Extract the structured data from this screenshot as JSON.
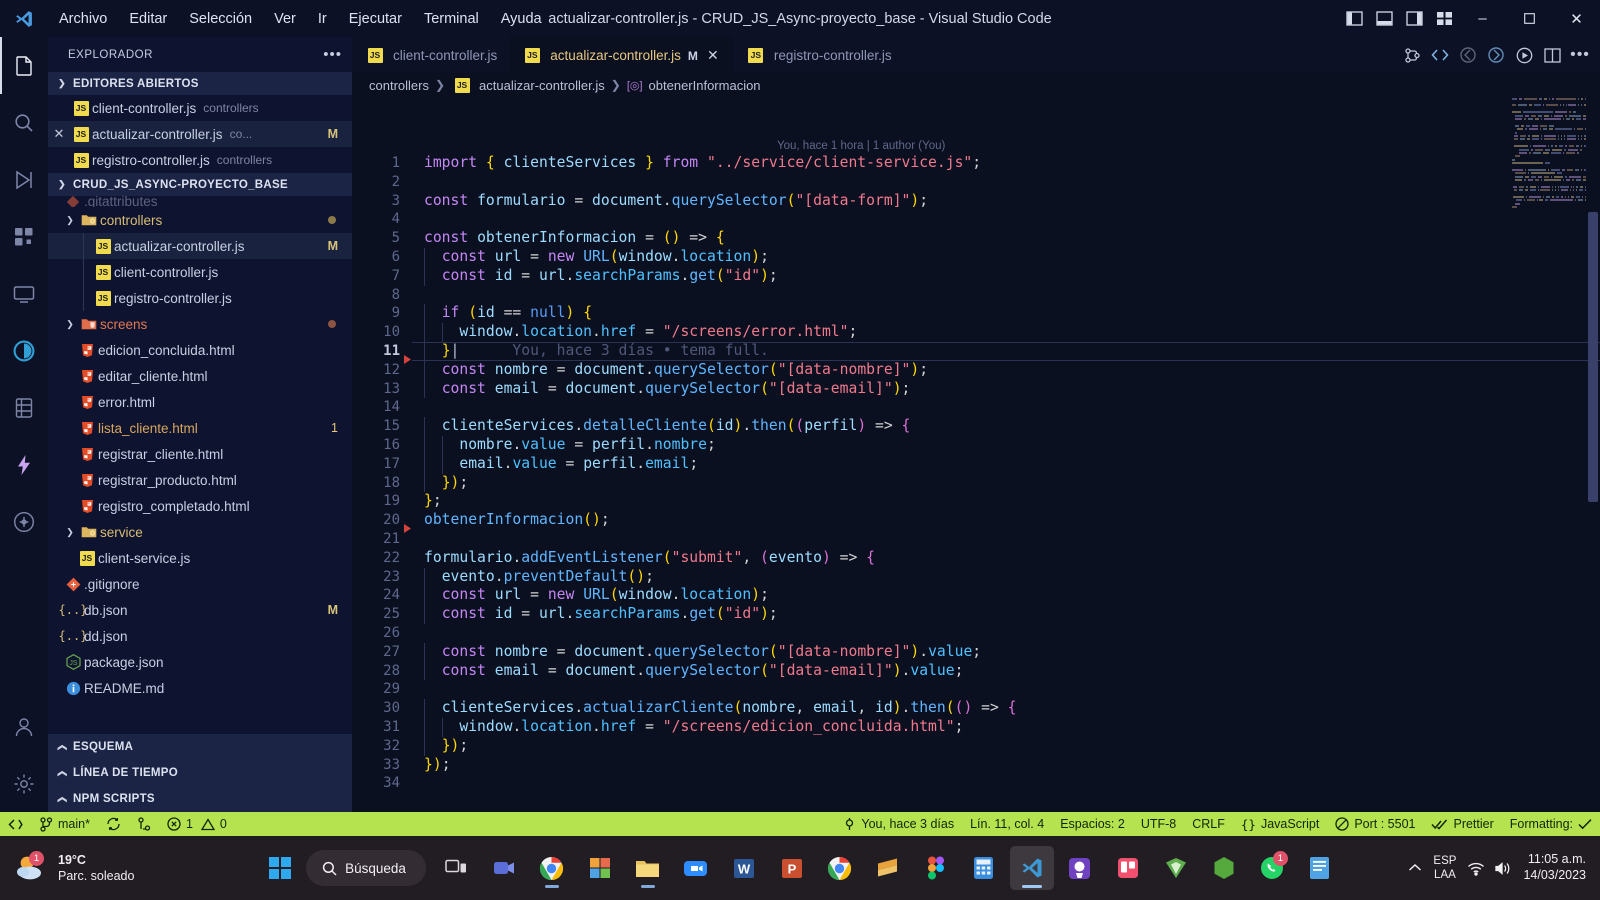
{
  "titlebar": {
    "logo_icon": "vscode-logo-icon",
    "menus": [
      "Archivo",
      "Editar",
      "Selección",
      "Ver",
      "Ir",
      "Ejecutar",
      "Terminal",
      "Ayuda"
    ],
    "window_title": "actualizar-controller.js - CRUD_JS_Async-proyecto_base - Visual Studio Code",
    "layout_icons": [
      "toggle-primary-sidebar-icon",
      "toggle-panel-icon",
      "toggle-secondary-sidebar-icon",
      "customize-layout-icon"
    ],
    "window_controls": {
      "minimize": "–",
      "maximize": "❐",
      "close": "✕"
    }
  },
  "activitybar": {
    "items": [
      {
        "name": "explorer",
        "icon": "files-icon",
        "active": true
      },
      {
        "name": "search",
        "icon": "search-icon",
        "active": false
      },
      {
        "name": "run-and-debug",
        "icon": "debug-icon",
        "active": false
      },
      {
        "name": "extensions",
        "icon": "extensions-icon",
        "active": false
      },
      {
        "name": "remote-explorer",
        "icon": "remote-monitor-icon",
        "active": false
      },
      {
        "name": "docker",
        "icon": "docker-whale-icon",
        "active": false
      },
      {
        "name": "database",
        "icon": "database-icon",
        "active": false
      },
      {
        "name": "thunder-client",
        "icon": "lightning-bolt-icon",
        "active": false
      },
      {
        "name": "live-share",
        "icon": "live-share-icon",
        "active": false
      }
    ],
    "bottom": [
      {
        "name": "accounts",
        "icon": "account-icon"
      },
      {
        "name": "manage-settings",
        "icon": "gear-icon"
      }
    ]
  },
  "sidebar": {
    "title": "EXPLORADOR",
    "more_actions_icon": "ellipsis-icon",
    "open_editors": {
      "label": "EDITORES ABIERTOS",
      "expanded": true,
      "items": [
        {
          "name": "client-controller.js",
          "folder": "controllers",
          "icon": "js-file-icon",
          "modified": false,
          "active": false,
          "show_close": false
        },
        {
          "name": "actualizar-controller.js",
          "folder": "co...",
          "icon": "js-file-icon",
          "modified": true,
          "badge": "M",
          "active": true,
          "show_close": true
        },
        {
          "name": "registro-controller.js",
          "folder": "controllers",
          "icon": "js-file-icon",
          "modified": false,
          "active": false,
          "show_close": false
        }
      ]
    },
    "project": {
      "label": "CRUD_JS_ASYNC-PROYECTO_BASE",
      "expanded": true,
      "items": [
        {
          "name": "controllers",
          "type": "folder",
          "icon": "folder-gear-icon",
          "indent": 1,
          "expanded": true,
          "dot": true
        },
        {
          "name": "actualizar-controller.js",
          "type": "file",
          "icon": "js-file-icon",
          "indent": 3,
          "badge": "M",
          "selected": true,
          "guide": true
        },
        {
          "name": "client-controller.js",
          "type": "file",
          "icon": "js-file-icon",
          "indent": 3,
          "guide": true
        },
        {
          "name": "registro-controller.js",
          "type": "file",
          "icon": "js-file-icon",
          "indent": 3,
          "guide": true
        },
        {
          "name": "screens",
          "type": "folder",
          "icon": "folder-html-icon",
          "indent": 1,
          "expanded": true,
          "dot": true
        },
        {
          "name": "edicion_concluida.html",
          "type": "file",
          "icon": "html5-icon",
          "indent": 2
        },
        {
          "name": "editar_cliente.html",
          "type": "file",
          "icon": "html5-icon",
          "indent": 2
        },
        {
          "name": "error.html",
          "type": "file",
          "icon": "html5-icon",
          "indent": 2
        },
        {
          "name": "lista_cliente.html",
          "type": "file",
          "icon": "html5-icon",
          "indent": 2,
          "badge_num": "1",
          "warn": true
        },
        {
          "name": "registrar_cliente.html",
          "type": "file",
          "icon": "html5-icon",
          "indent": 2
        },
        {
          "name": "registrar_producto.html",
          "type": "file",
          "icon": "html5-icon",
          "indent": 2
        },
        {
          "name": "registro_completado.html",
          "type": "file",
          "icon": "html5-icon",
          "indent": 2
        },
        {
          "name": "service",
          "type": "folder",
          "icon": "folder-gear-icon",
          "indent": 1,
          "expanded": true
        },
        {
          "name": "client-service.js",
          "type": "file",
          "icon": "js-file-icon",
          "indent": 2
        },
        {
          "name": ".gitignore",
          "type": "file",
          "icon": "git-icon",
          "indent": 1
        },
        {
          "name": "db.json",
          "type": "file",
          "icon": "json-icon",
          "indent": 1,
          "badge": "M"
        },
        {
          "name": "dd.json",
          "type": "file",
          "icon": "json-icon",
          "indent": 1
        },
        {
          "name": "package.json",
          "type": "file",
          "icon": "nodejs-icon",
          "indent": 1
        },
        {
          "name": "README.md",
          "type": "file",
          "icon": "info-icon",
          "indent": 1
        }
      ]
    },
    "collapsed_sections": [
      {
        "label": "ESQUEMA"
      },
      {
        "label": "LÍNEA DE TIEMPO"
      },
      {
        "label": "NPM SCRIPTS"
      }
    ]
  },
  "editor": {
    "tabs": [
      {
        "label": "client-controller.js",
        "icon": "js-file-icon",
        "active": false,
        "modified": false
      },
      {
        "label": "actualizar-controller.js",
        "icon": "js-file-icon",
        "active": true,
        "modified": true,
        "modified_badge": "M",
        "close_icon": "close-icon"
      },
      {
        "label": "registro-controller.js",
        "icon": "js-file-icon",
        "active": false,
        "modified": false
      }
    ],
    "tab_actions": [
      "source-control-graph-icon",
      "live-share-icon",
      "go-live-back-icon",
      "go-live-forward-icon",
      "run-play-icon",
      "split-editor-icon",
      "more-actions-icon"
    ],
    "breadcrumb": [
      {
        "label": "controllers",
        "icon": null
      },
      {
        "label": "actualizar-controller.js",
        "icon": "js-file-icon"
      },
      {
        "label": "obtenerInformacion",
        "icon": "symbol-variable-icon"
      }
    ],
    "blame_author_line": "You, hace 1 hora | 1 author (You)",
    "current_line_blame": "You, hace 3 días • tema full.",
    "cursor_line": 11,
    "total_lines": 34,
    "breakpoint_lines": [
      11,
      20
    ]
  },
  "code_lines": [
    {
      "n": 1,
      "text": "import { clienteServices } from \"../service/client-service.js\";"
    },
    {
      "n": 2,
      "text": ""
    },
    {
      "n": 3,
      "text": "const formulario = document.querySelector(\"[data-form]\");"
    },
    {
      "n": 4,
      "text": ""
    },
    {
      "n": 5,
      "text": "const obtenerInformacion = () => {"
    },
    {
      "n": 6,
      "text": "  const url = new URL(window.location);"
    },
    {
      "n": 7,
      "text": "  const id = url.searchParams.get(\"id\");"
    },
    {
      "n": 8,
      "text": ""
    },
    {
      "n": 9,
      "text": "  if (id == null) {"
    },
    {
      "n": 10,
      "text": "    window.location.href = \"/screens/error.html\";"
    },
    {
      "n": 11,
      "text": "  }"
    },
    {
      "n": 12,
      "text": "  const nombre = document.querySelector(\"[data-nombre]\");"
    },
    {
      "n": 13,
      "text": "  const email = document.querySelector(\"[data-email]\");"
    },
    {
      "n": 14,
      "text": ""
    },
    {
      "n": 15,
      "text": "  clienteServices.detalleCliente(id).then((perfil) => {"
    },
    {
      "n": 16,
      "text": "    nombre.value = perfil.nombre;"
    },
    {
      "n": 17,
      "text": "    email.value = perfil.email;"
    },
    {
      "n": 18,
      "text": "  });"
    },
    {
      "n": 19,
      "text": "};"
    },
    {
      "n": 20,
      "text": "obtenerInformacion();"
    },
    {
      "n": 21,
      "text": ""
    },
    {
      "n": 22,
      "text": "formulario.addEventListener(\"submit\", (evento) => {"
    },
    {
      "n": 23,
      "text": "  evento.preventDefault();"
    },
    {
      "n": 24,
      "text": "  const url = new URL(window.location);"
    },
    {
      "n": 25,
      "text": "  const id = url.searchParams.get(\"id\");"
    },
    {
      "n": 26,
      "text": ""
    },
    {
      "n": 27,
      "text": "  const nombre = document.querySelector(\"[data-nombre]\").value;"
    },
    {
      "n": 28,
      "text": "  const email = document.querySelector(\"[data-email]\").value;"
    },
    {
      "n": 29,
      "text": ""
    },
    {
      "n": 30,
      "text": "  clienteServices.actualizarCliente(nombre, email, id).then(() => {"
    },
    {
      "n": 31,
      "text": "    window.location.href = \"/screens/edicion_concluida.html\";"
    },
    {
      "n": 32,
      "text": "  });"
    },
    {
      "n": 33,
      "text": "});"
    },
    {
      "n": 34,
      "text": ""
    }
  ],
  "statusbar": {
    "background_color": "#b4e34f",
    "left": [
      {
        "name": "remote-host",
        "icon": "remote-icon",
        "label": ""
      },
      {
        "name": "branch",
        "icon": "source-control-icon",
        "label": "main*"
      },
      {
        "name": "sync-changes",
        "icon": "sync-icon",
        "label": ""
      },
      {
        "name": "checkout-branch",
        "icon": "git-branch-icon",
        "label": ""
      },
      {
        "name": "problems",
        "icon": "error-warning-icon",
        "label": "1  0",
        "errors": "1",
        "warnings": "0"
      }
    ],
    "right": [
      {
        "name": "git-blame",
        "icon": "git-commit-icon",
        "label": "You, hace 3 días"
      },
      {
        "name": "cursor-position",
        "label": "Lín. 11, col. 4"
      },
      {
        "name": "indentation",
        "label": "Espacios: 2"
      },
      {
        "name": "encoding",
        "label": "UTF-8"
      },
      {
        "name": "eol",
        "label": "CRLF"
      },
      {
        "name": "language-mode",
        "icon": "braces-icon",
        "label": "JavaScript"
      },
      {
        "name": "live-server-port",
        "icon": "broadcast-icon",
        "label": "Port : 5501"
      },
      {
        "name": "prettier",
        "icon": "check-check-icon",
        "label": "Prettier"
      },
      {
        "name": "formatting",
        "icon": "check-icon",
        "label": "Formatting:"
      }
    ]
  },
  "taskbar": {
    "weather": {
      "temperature": "19°C",
      "condition": "Parc. soleado",
      "icon": "partly-sunny-icon",
      "badge": "1"
    },
    "start_icon": "windows-start-icon",
    "search": {
      "label": "Búsqueda",
      "icon": "search-icon"
    },
    "apps": [
      {
        "name": "task-view",
        "icon": "task-view-icon"
      },
      {
        "name": "microsoft-teams",
        "icon": "teams-icon"
      },
      {
        "name": "google-chrome",
        "icon": "chrome-icon",
        "running": true
      },
      {
        "name": "microsoft-store",
        "icon": "store-icon"
      },
      {
        "name": "file-explorer",
        "icon": "folder-icon",
        "running": true
      },
      {
        "name": "zoom",
        "icon": "zoom-icon"
      },
      {
        "name": "microsoft-word",
        "icon": "word-icon"
      },
      {
        "name": "microsoft-powerpoint",
        "icon": "powerpoint-icon"
      },
      {
        "name": "chrome-alt",
        "icon": "chrome-icon"
      },
      {
        "name": "sublime-text",
        "icon": "sublime-icon"
      },
      {
        "name": "figma",
        "icon": "figma-icon"
      },
      {
        "name": "calculator",
        "icon": "calculator-icon"
      },
      {
        "name": "visual-studio-code",
        "icon": "vscode-icon",
        "active": true
      },
      {
        "name": "github-desktop",
        "icon": "github-desktop-icon"
      },
      {
        "name": "trello",
        "icon": "trello-icon"
      },
      {
        "name": "vite",
        "icon": "vite-icon"
      },
      {
        "name": "node-app",
        "icon": "node-icon"
      },
      {
        "name": "whatsapp",
        "icon": "whatsapp-icon",
        "badge": "1"
      },
      {
        "name": "notepad",
        "icon": "notepad-icon"
      }
    ],
    "tray": {
      "chevron_icon": "chevron-up-icon",
      "keyboard_layout_line1": "ESP",
      "keyboard_layout_line2": "LAA",
      "network_icon": "wifi-icon",
      "volume_icon": "volume-icon",
      "time": "11:05 a.m.",
      "date": "14/03/2023"
    }
  }
}
